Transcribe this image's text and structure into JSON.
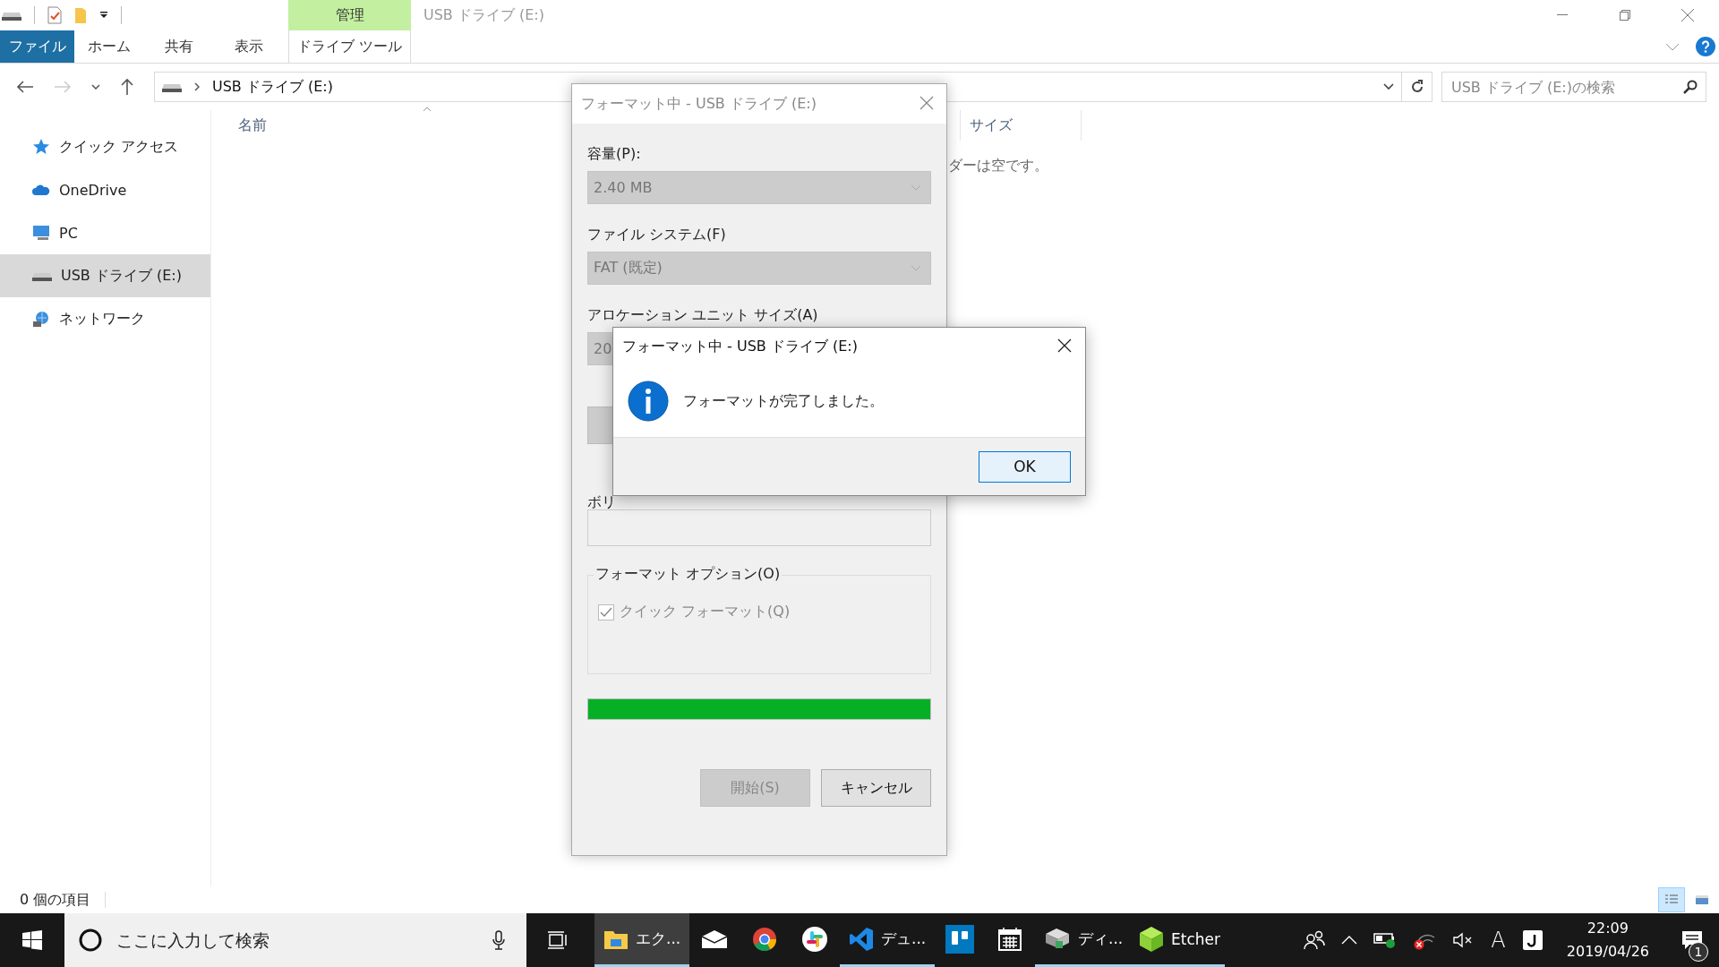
{
  "window": {
    "title": "USB ドライブ (E:)",
    "context_tab": "管理"
  },
  "ribbon_tabs": [
    {
      "label": "ファイル",
      "kind": "file",
      "selected": false
    },
    {
      "label": "ホーム",
      "kind": "tab",
      "selected": false
    },
    {
      "label": "共有",
      "kind": "tab",
      "selected": false
    },
    {
      "label": "表示",
      "kind": "tab",
      "selected": false
    },
    {
      "label": "ドライブ ツール",
      "kind": "context",
      "selected": true
    }
  ],
  "address": {
    "path": "USB ドライブ (E:)"
  },
  "search": {
    "placeholder": "USB ドライブ (E:)の検索"
  },
  "nav": [
    {
      "label": "クイック アクセス",
      "kind": "quick",
      "selected": false
    },
    {
      "label": "OneDrive",
      "kind": "cloud",
      "selected": false
    },
    {
      "label": "PC",
      "kind": "pc",
      "selected": false
    },
    {
      "label": "USB ドライブ (E:)",
      "kind": "drive",
      "selected": true
    },
    {
      "label": "ネットワーク",
      "kind": "network",
      "selected": false
    }
  ],
  "columns": [
    "名前",
    "サイズ"
  ],
  "empty_message": "ダーは空です。",
  "status_bar": {
    "count": "0 個の項目"
  },
  "view_buttons": [
    {
      "kind": "details",
      "selected": true
    },
    {
      "kind": "tiles",
      "selected": false
    }
  ],
  "format_dialog": {
    "title": "フォーマット中 - USB ドライブ (E:)",
    "capacity_label": "容量(P):",
    "capacity_value": "2.40 MB",
    "fs_label": "ファイル システム(F)",
    "fs_value": "FAT (既定)",
    "alloc_label": "アロケーション ユニット サイズ(A)",
    "alloc_value": "20",
    "volume_label": "ボリ",
    "options_legend": "フォーマット オプション(O)",
    "quick_format": {
      "label": "クイック フォーマット(Q)",
      "checked": true,
      "disabled": true
    },
    "progress": {
      "level": 1
    },
    "buttons": [
      {
        "label": "開始(S)",
        "disabled": true
      },
      {
        "label": "キャンセル",
        "disabled": false
      }
    ]
  },
  "message_box": {
    "title": "フォーマット中 - USB ドライブ (E:)",
    "message": "フォーマットが完了しました。",
    "ok": "OK"
  },
  "taskbar": {
    "search_placeholder": "ここに入力して検索",
    "apps": [
      {
        "kind": "explorer",
        "label": "エク...",
        "running": true,
        "selected": true
      },
      {
        "kind": "mail",
        "running": false,
        "selected": false
      },
      {
        "kind": "chrome",
        "running": false,
        "selected": false
      },
      {
        "kind": "slack",
        "running": false,
        "selected": false
      },
      {
        "kind": "vscode",
        "label": "デュ...",
        "running": true,
        "selected": false
      },
      {
        "kind": "trello",
        "running": false,
        "selected": false
      },
      {
        "kind": "calendar",
        "running": false,
        "selected": false
      },
      {
        "kind": "disk",
        "label": "ディ...",
        "running": true,
        "selected": false
      },
      {
        "kind": "etcher",
        "label": "Etcher",
        "running": true,
        "selected": false
      }
    ],
    "ime": "A",
    "time": "22:09",
    "date": "2019/04/26",
    "notifications": "1"
  }
}
